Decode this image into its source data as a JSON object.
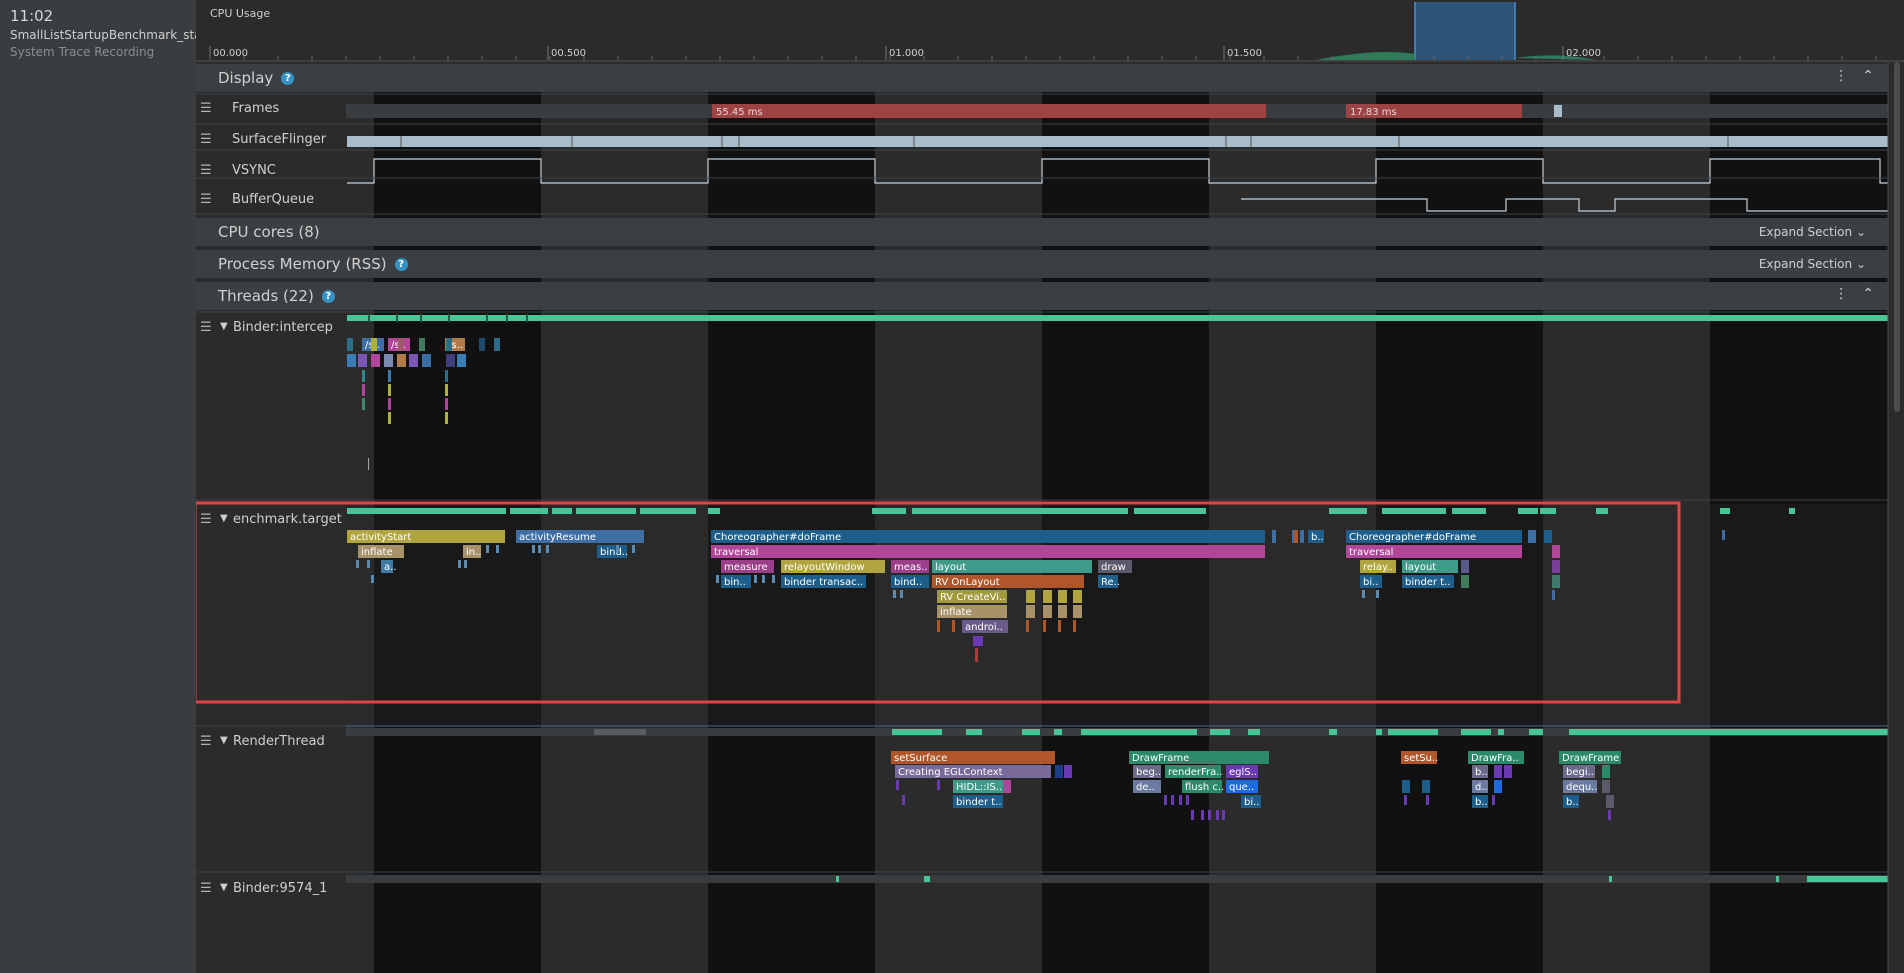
{
  "recording": {
    "time": "11:02",
    "name": "SmallListStartupBenchmark_start...",
    "type": "System Trace Recording"
  },
  "cpu_usage": {
    "title": "CPU Usage",
    "ticks": [
      "00.000",
      "00.500",
      "01.000",
      "01.500",
      "02.000"
    ]
  },
  "sections": {
    "display": {
      "title": "Display",
      "help": "?"
    },
    "cpu_cores": {
      "title": "CPU cores (8)",
      "expand": "Expand Section"
    },
    "process_memory": {
      "title": "Process Memory (RSS)",
      "help": "?",
      "expand": "Expand Section"
    },
    "threads": {
      "title": "Threads (22)",
      "help": "?"
    }
  },
  "display_rows": [
    "Frames",
    "SurfaceFlinger",
    "VSYNC",
    "BufferQueue"
  ],
  "frames": {
    "frame1": "55.45 ms",
    "frame2": "17.83 ms"
  },
  "threads": {
    "binder_intercep": {
      "label": "Binder:intercep",
      "slices": [
        "/s..",
        "/s..",
        "/s.."
      ]
    },
    "benchmark_target": {
      "label": "enchmark.target",
      "slices": [
        "activityStart",
        "activityResume",
        "inflate",
        "in..",
        "a..",
        "bind..",
        "Choreographer#doFrame",
        "traversal",
        "measure",
        "relayoutWindow",
        "meas..",
        "layout",
        "draw",
        "bin..",
        "binder transac..",
        "bind..",
        "RV OnLayout",
        "Re..",
        "RV CreateVi..",
        "inflate",
        "androi..",
        "b..",
        "Choreographer#doFrame",
        "traversal",
        "relay..",
        "layout",
        "bi..",
        "binder t.."
      ]
    },
    "render_thread": {
      "label": "RenderThread",
      "slices": [
        "setSurface",
        "Creating EGLContext",
        "HIDL::IS..",
        "binder t..",
        "DrawFrame",
        "beg..",
        "renderFra..",
        "eglS..",
        "de..",
        "flush c..",
        "que..",
        "bi..",
        "setSu..",
        "DrawFra..",
        "b..",
        "d..",
        "b..",
        "DrawFrame",
        "begi..",
        "dequ..",
        "b.."
      ]
    },
    "binder_9574": {
      "label": "Binder:9574_1"
    }
  },
  "colors": {
    "background": "#2b2b2b",
    "left_panel": "#3a3d40",
    "section_header": "#3c3f41",
    "highlight_box": "#e04444",
    "selection": "#2e5a85",
    "track_dark": "#111111",
    "track_light": "#2b2b2b",
    "state_running": "#48c495",
    "frames_bar": "#9e4343",
    "surfaceflinger": "#a9bcc9"
  },
  "icons": [
    "help-icon",
    "more-options-icon",
    "collapse-icon",
    "expand-chevron-icon",
    "drag-handle-icon",
    "tree-arrow-icon"
  ]
}
